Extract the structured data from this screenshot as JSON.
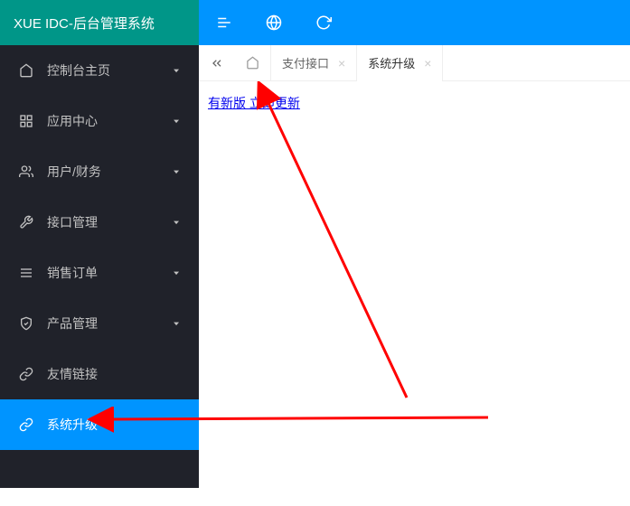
{
  "app": {
    "title": "XUE IDC-后台管理系统"
  },
  "sidebar": {
    "items": [
      {
        "icon": "home",
        "label": "控制台主页",
        "expandable": true
      },
      {
        "icon": "grid",
        "label": "应用中心",
        "expandable": true
      },
      {
        "icon": "users",
        "label": "用户/财务",
        "expandable": true
      },
      {
        "icon": "wrench",
        "label": "接口管理",
        "expandable": true
      },
      {
        "icon": "list",
        "label": "销售订单",
        "expandable": true
      },
      {
        "icon": "shield",
        "label": "产品管理",
        "expandable": true
      },
      {
        "icon": "link",
        "label": "友情链接",
        "expandable": false
      },
      {
        "icon": "link",
        "label": "系统升级",
        "expandable": false,
        "active": true
      }
    ]
  },
  "tabs": [
    {
      "label": "支付接口",
      "active": false
    },
    {
      "label": "系统升级",
      "active": true
    }
  ],
  "content": {
    "update_link": "有新版 立即更新"
  },
  "annotations": {
    "arrow1_color": "#ff0000",
    "arrow2_color": "#ff0000"
  }
}
